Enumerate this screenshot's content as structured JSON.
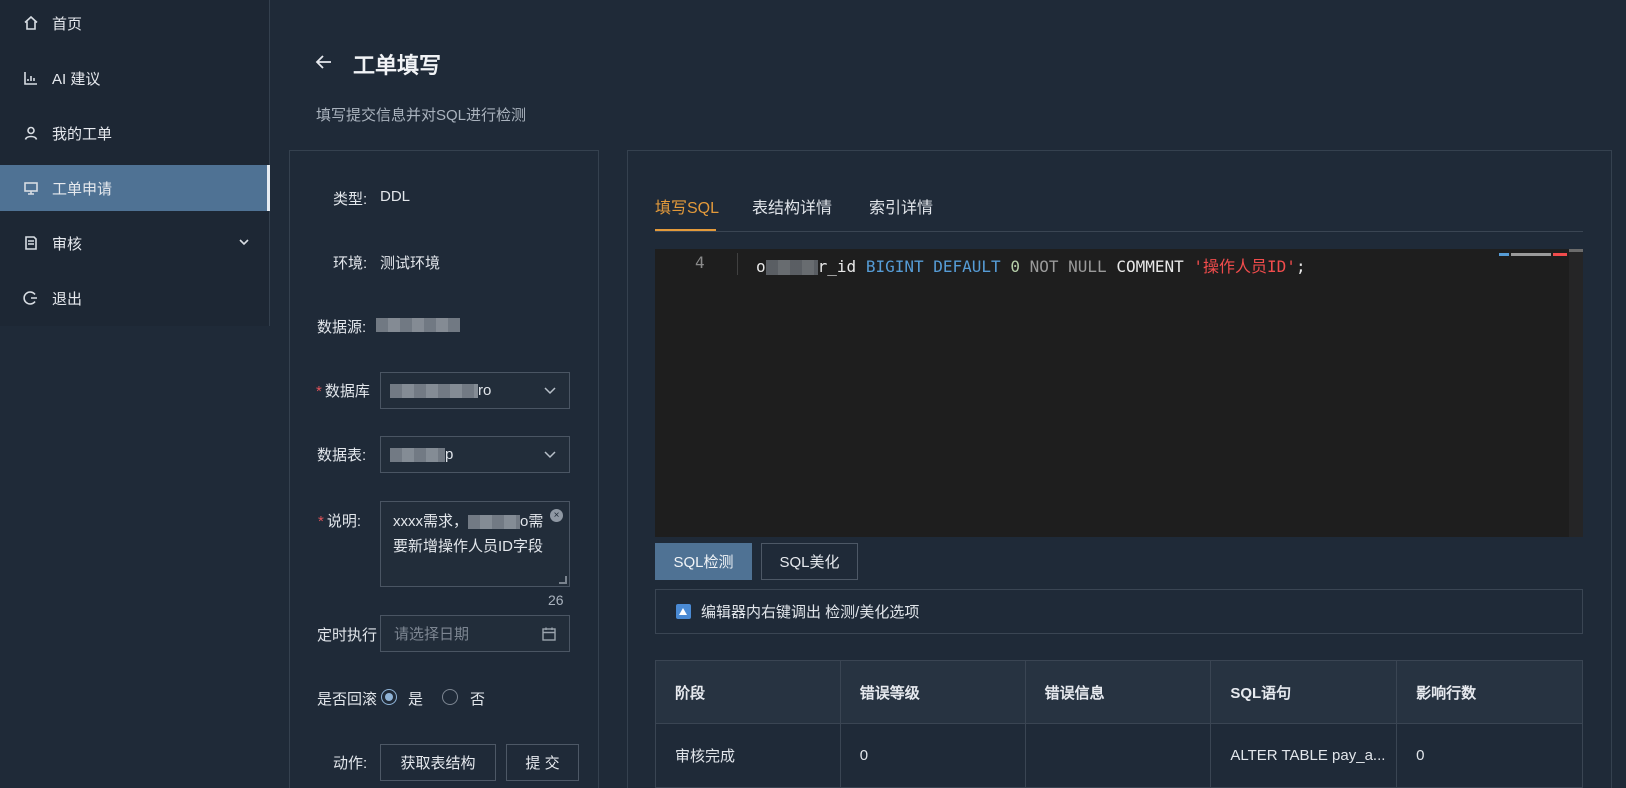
{
  "sidebar": {
    "items": [
      {
        "label": "首页",
        "icon": "home-icon"
      },
      {
        "label": "AI 建议",
        "icon": "chart-icon"
      },
      {
        "label": "我的工单",
        "icon": "user-icon"
      },
      {
        "label": "工单申请",
        "icon": "monitor-icon",
        "active": true
      },
      {
        "label": "审核",
        "icon": "document-icon",
        "expandable": true
      },
      {
        "label": "退出",
        "icon": "logout-icon"
      }
    ]
  },
  "header": {
    "title": "工单填写",
    "subtitle": "填写提交信息并对SQL进行检测"
  },
  "form": {
    "type_label": "类型:",
    "type_value": "DDL",
    "env_label": "环境:",
    "env_value": "测试环境",
    "datasource_label": "数据源:",
    "database_label": "数据库",
    "database_value_suffix": "ro",
    "table_label": "数据表:",
    "table_value_suffix": "p",
    "desc_label": "说明:",
    "desc_value_prefix": "xxxx需求，",
    "desc_value_suffix": "o需要新增操作人员ID字段",
    "desc_count": "26",
    "schedule_label": "定时执行",
    "schedule_placeholder": "请选择日期",
    "rollback_label": "是否回滚",
    "rollback_yes": "是",
    "rollback_no": "否",
    "rollback_value": "是",
    "action_label": "动作:",
    "get_schema_button": "获取表结构",
    "submit_button": "提 交"
  },
  "tabs": [
    {
      "label": "填写SQL",
      "active": true
    },
    {
      "label": "表结构详情"
    },
    {
      "label": "索引详情"
    }
  ],
  "editor": {
    "line_number": "4",
    "code_prefix": "o",
    "code_after_mask": "r_id",
    "kw_bigint": "BIGINT",
    "kw_default": "DEFAULT",
    "num_zero": "0",
    "kw_not_null": "NOT NULL",
    "kw_comment": "COMMENT",
    "str_comment": "'操作人员ID'",
    "semicolon": ";"
  },
  "sql_buttons": {
    "check": "SQL检测",
    "beautify": "SQL美化"
  },
  "hint": "编辑器内右键调出 检测/美化选项",
  "result_table": {
    "headers": [
      "阶段",
      "错误等级",
      "错误信息",
      "SQL语句",
      "影响行数"
    ],
    "rows": [
      [
        "审核完成",
        "0",
        "",
        "ALTER TABLE pay_a...",
        "0"
      ]
    ]
  },
  "colors": {
    "accent_orange": "#e39a3b",
    "active_nav_bg": "#4f7294",
    "background": "#1f2a38"
  }
}
